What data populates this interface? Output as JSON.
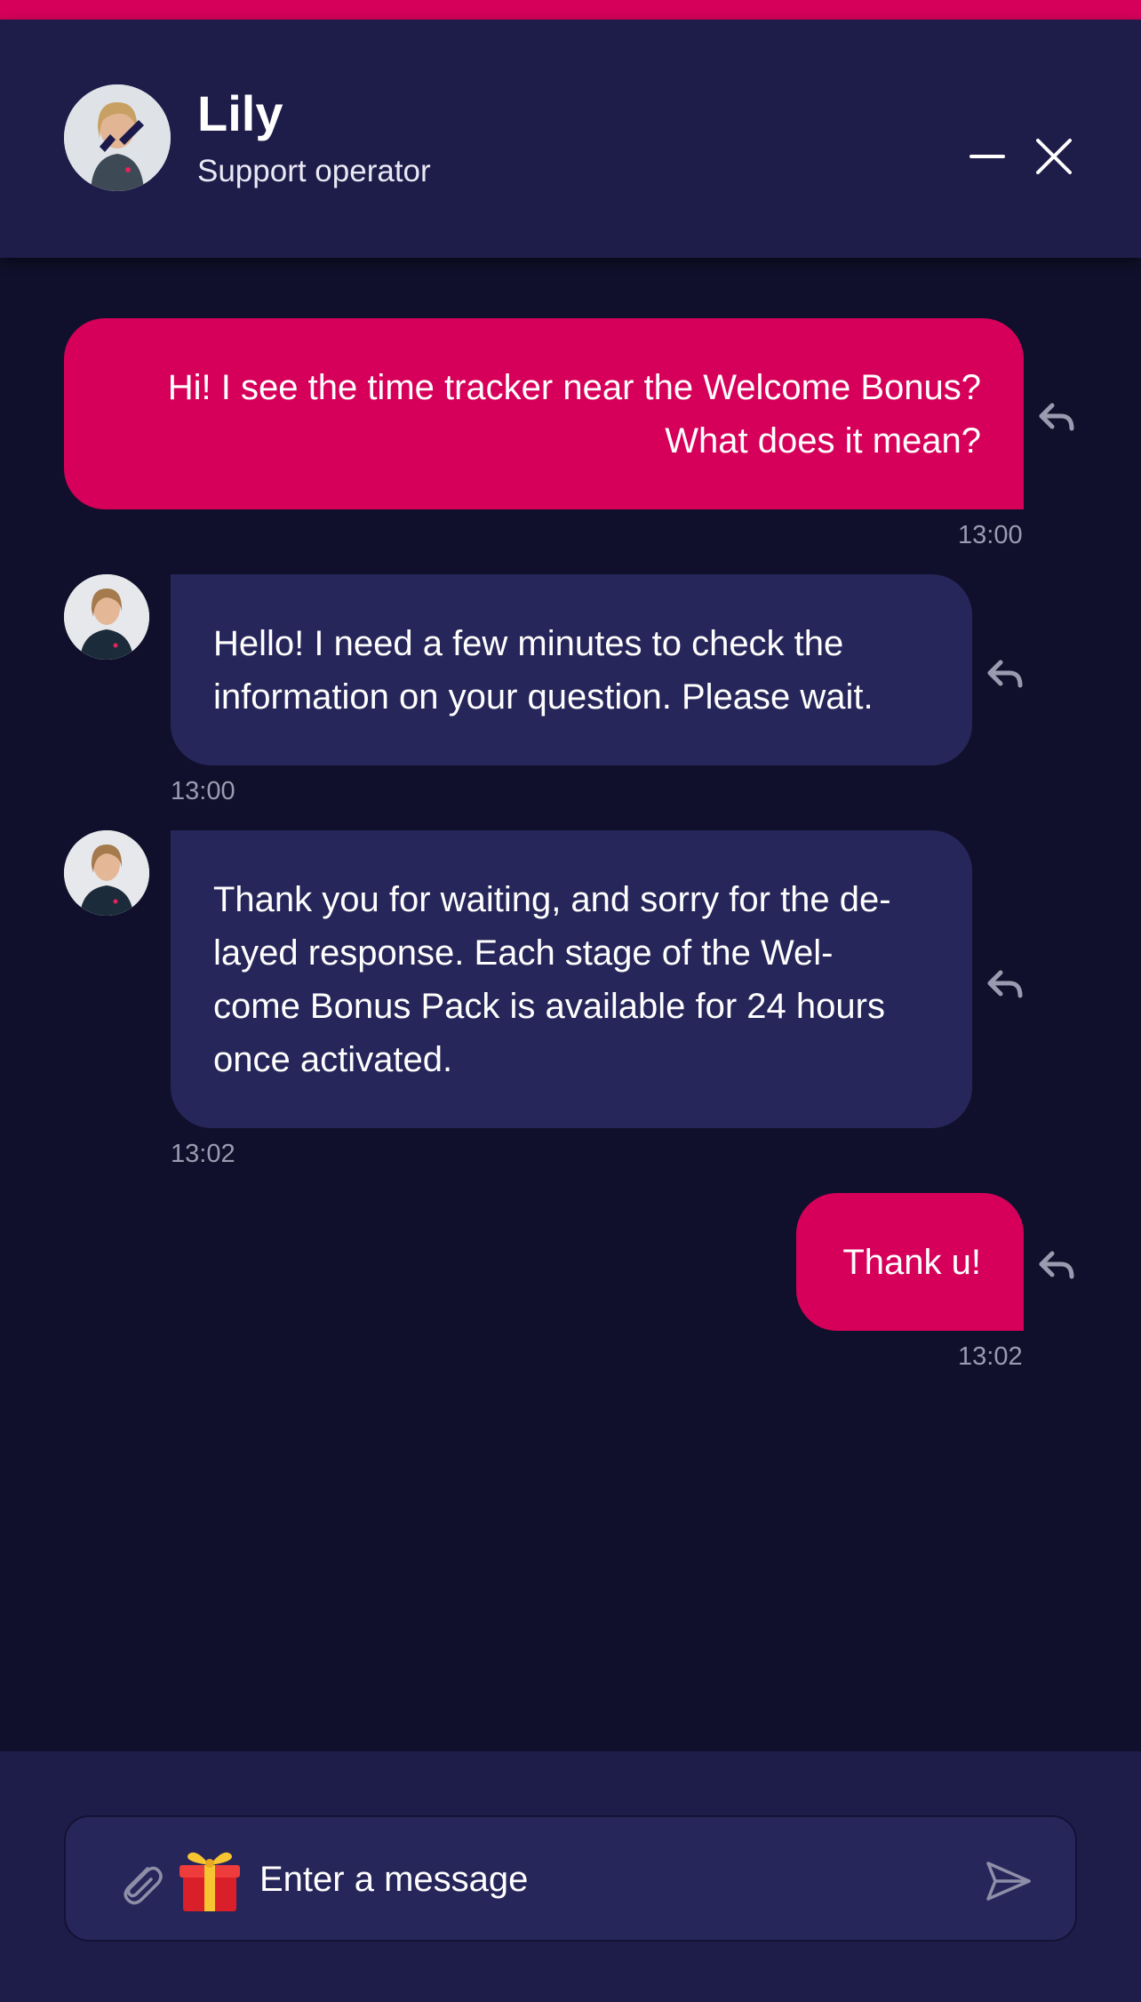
{
  "colors": {
    "accent": "#d6005a",
    "header_bg": "#1e1c48",
    "chat_bg": "#10102c",
    "incoming_bubble": "#27265a",
    "timestamp": "#9a9ab0"
  },
  "header": {
    "name": "Lily",
    "role": "Support operator",
    "minimize_icon": "minimize-icon",
    "close_icon": "close-icon"
  },
  "messages": [
    {
      "direction": "outgoing",
      "lines": [
        "Hi! I see the time tracker near the Welcome Bonus?",
        "What does it mean?"
      ],
      "time": "13:00"
    },
    {
      "direction": "incoming",
      "lines": [
        "Hello! I need a few minutes to check the",
        "information on your question. Please wait."
      ],
      "time": "13:00"
    },
    {
      "direction": "incoming",
      "lines": [
        "Thank you for waiting, and sorry for the de-",
        "layed response. Each stage of the Wel-",
        "come Bonus Pack is available for 24 hours",
        "once activated."
      ],
      "time": "13:02"
    },
    {
      "direction": "outgoing",
      "lines": [
        "Thank u!"
      ],
      "time": "13:02"
    }
  ],
  "composer": {
    "placeholder": "Enter a message",
    "attach_icon": "paperclip-icon",
    "gift_icon": "gift-icon",
    "send_icon": "send-icon"
  }
}
